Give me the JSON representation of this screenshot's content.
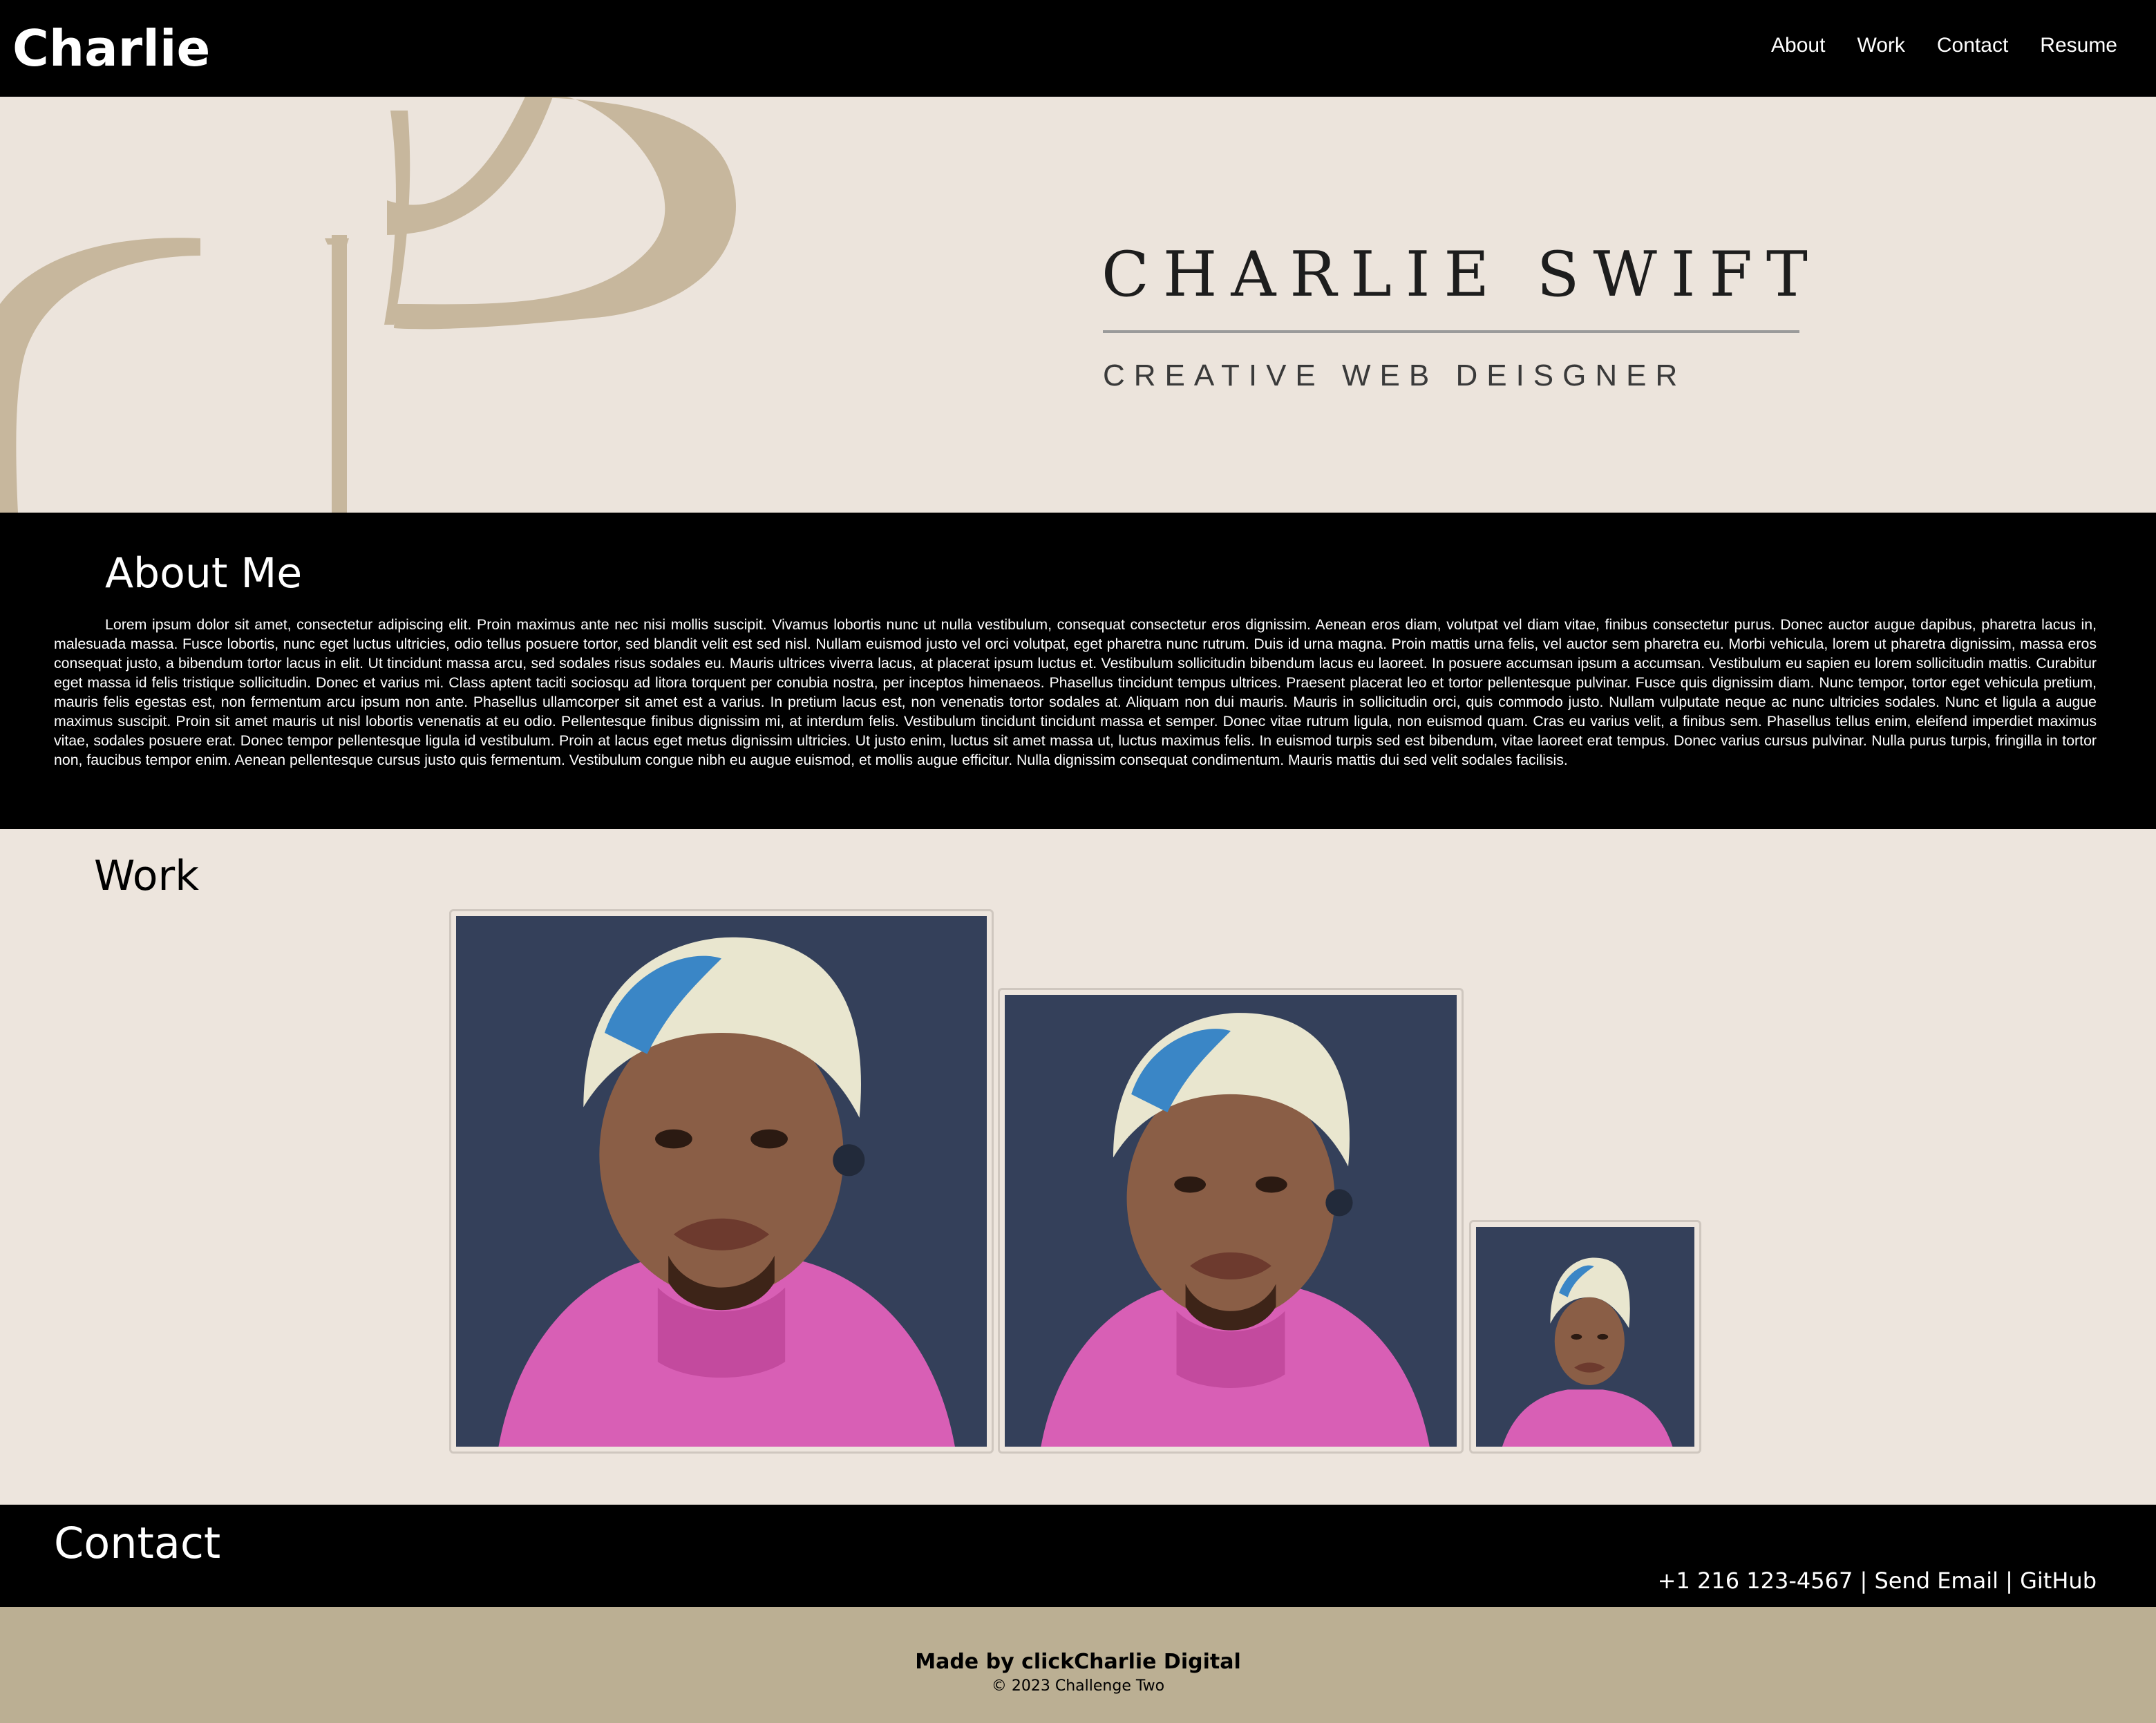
{
  "nav": {
    "brand": "Charlie",
    "links": [
      "About",
      "Work",
      "Contact",
      "Resume"
    ]
  },
  "hero": {
    "name": "CHARLIE SWIFT",
    "subtitle": "CREATIVE WEB DEISGNER"
  },
  "about": {
    "title": "About Me",
    "text": "Lorem ipsum dolor sit amet, consectetur adipiscing elit. Proin maximus ante nec nisi mollis suscipit. Vivamus lobortis nunc ut nulla vestibulum, consequat consectetur eros dignissim. Aenean eros diam, volutpat vel diam vitae, finibus consectetur purus. Donec auctor augue dapibus, pharetra lacus in, malesuada massa. Fusce lobortis, nunc eget luctus ultricies, odio tellus posuere tortor, sed blandit velit est sed nisl. Nullam euismod justo vel orci volutpat, eget pharetra nunc rutrum. Duis id urna magna. Proin mattis urna felis, vel auctor sem pharetra eu. Morbi vehicula, lorem ut pharetra dignissim, massa eros consequat justo, a bibendum tortor lacus in elit. Ut tincidunt massa arcu, sed sodales risus sodales eu. Mauris ultrices viverra lacus, at placerat ipsum luctus et. Vestibulum sollicitudin bibendum lacus eu laoreet. In posuere accumsan ipsum a accumsan. Vestibulum eu sapien eu lorem sollicitudin mattis. Curabitur eget massa id felis tristique sollicitudin. Donec et varius mi. Class aptent taciti sociosqu ad litora torquent per conubia nostra, per inceptos himenaeos. Phasellus tincidunt tempus ultrices. Praesent placerat leo et tortor pellentesque pulvinar. Fusce quis dignissim diam. Nunc tempor, tortor eget vehicula pretium, mauris felis egestas est, non fermentum arcu ipsum non ante. Phasellus ullamcorper sit amet est a varius. In pretium lacus est, non venenatis tortor sodales at. Aliquam non dui mauris. Mauris in sollicitudin orci, quis commodo justo. Nullam vulputate neque ac nunc ultricies sodales. Nunc et ligula a augue maximus suscipit. Proin sit amet mauris ut nisl lobortis venenatis at eu odio. Pellentesque finibus dignissim mi, at interdum felis. Vestibulum tincidunt tincidunt massa et semper. Donec vitae rutrum ligula, non euismod quam. Cras eu varius velit, a finibus sem. Phasellus tellus enim, eleifend imperdiet maximus vitae, sodales posuere erat. Donec tempor pellentesque ligula id vestibulum. Proin at lacus eget metus dignissim ultricies. Ut justo enim, luctus sit amet massa ut, luctus maximus felis. In euismod turpis sed est bibendum, vitae laoreet erat tempus. Donec varius cursus pulvinar. Nulla purus turpis, fringilla in tortor non, faucibus tempor enim. Aenean pellentesque cursus justo quis fermentum. Vestibulum congue nibh eu augue euismod, et mollis augue efficitur. Nulla dignissim consequat condimentum. Mauris mattis dui sed velit sodales facilisis."
  },
  "work": {
    "title": "Work"
  },
  "contact": {
    "title": "Contact",
    "phone": "+1 216 123-4567",
    "sep": " | ",
    "email": "Send Email",
    "github": "GitHub"
  },
  "footer": {
    "made_by": "Made by clickCharlie Digital",
    "copyright": "© 2023 Challenge Two"
  },
  "colors": {
    "nav_bg": "#000000",
    "hero_bg": "#ece4dc",
    "accent": "#c7b79d",
    "footer_bg": "#bbaf93"
  }
}
